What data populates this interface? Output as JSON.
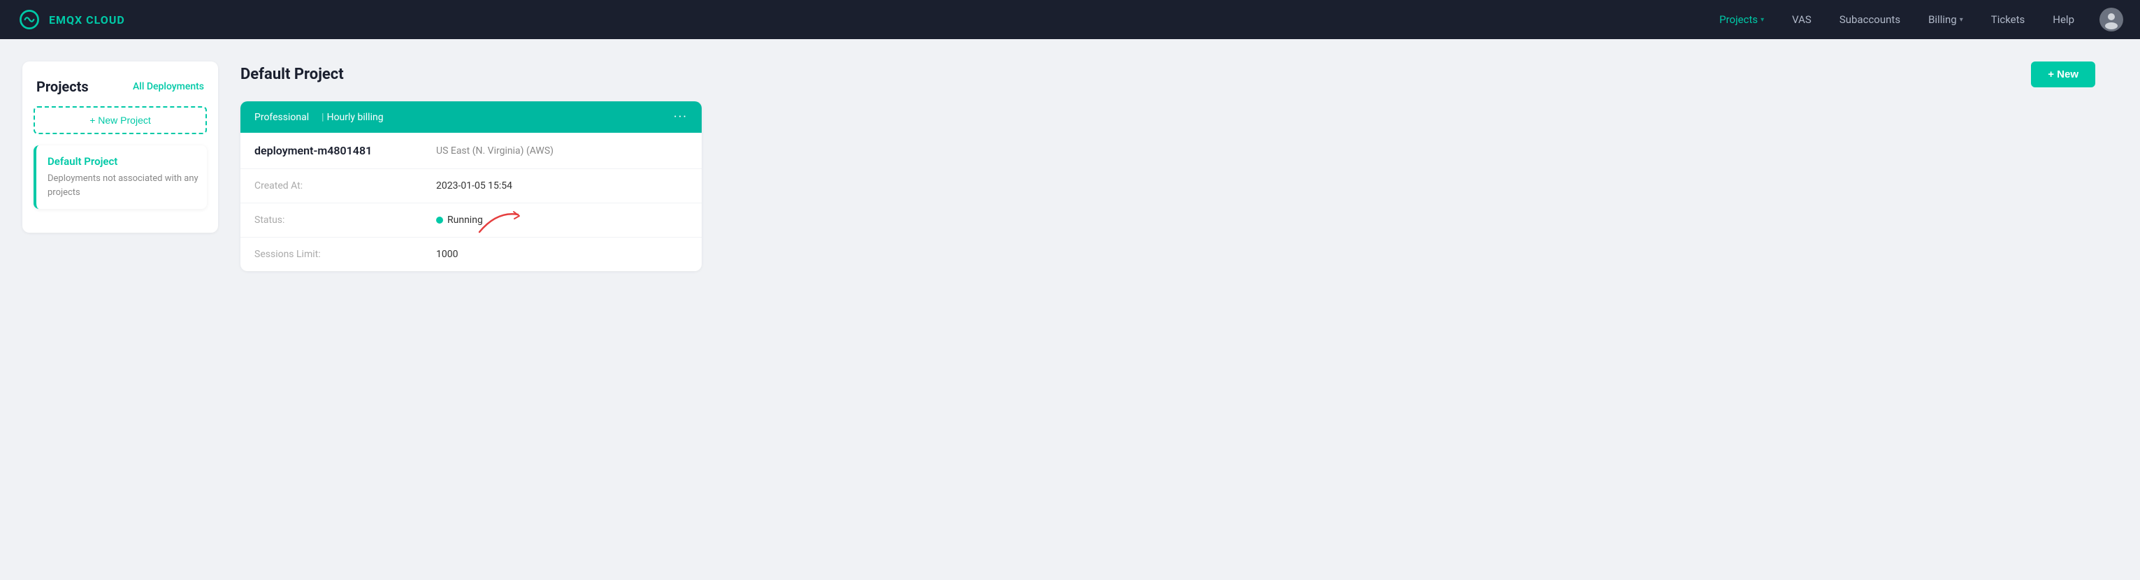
{
  "nav": {
    "logo_text": "EMQX CLOUD",
    "links": [
      {
        "label": "Projects",
        "active": true,
        "has_dropdown": true
      },
      {
        "label": "VAS",
        "active": false,
        "has_dropdown": false
      },
      {
        "label": "Subaccounts",
        "active": false,
        "has_dropdown": false
      },
      {
        "label": "Billing",
        "active": false,
        "has_dropdown": true
      },
      {
        "label": "Tickets",
        "active": false,
        "has_dropdown": false
      },
      {
        "label": "Help",
        "active": false,
        "has_dropdown": false
      }
    ]
  },
  "sidebar": {
    "title": "Projects",
    "all_deployments_label": "All Deployments",
    "new_project_label": "+ New Project",
    "projects": [
      {
        "name": "Default Project",
        "description": "Deployments not associated with any projects"
      }
    ]
  },
  "content": {
    "project_title": "Default Project",
    "new_button_label": "+ New",
    "deployment": {
      "plan": "Professional",
      "billing": "Hourly billing",
      "name": "deployment-m4801481",
      "region": "US East (N. Virginia) (AWS)",
      "created_at_label": "Created At:",
      "created_at_value": "2023-01-05 15:54",
      "status_label": "Status:",
      "status_value": "Running",
      "sessions_label": "Sessions Limit:",
      "sessions_value": "1000"
    }
  },
  "colors": {
    "brand_green": "#00c9a7",
    "nav_bg": "#1a1f2e",
    "card_header_bg": "#00b8a0"
  }
}
